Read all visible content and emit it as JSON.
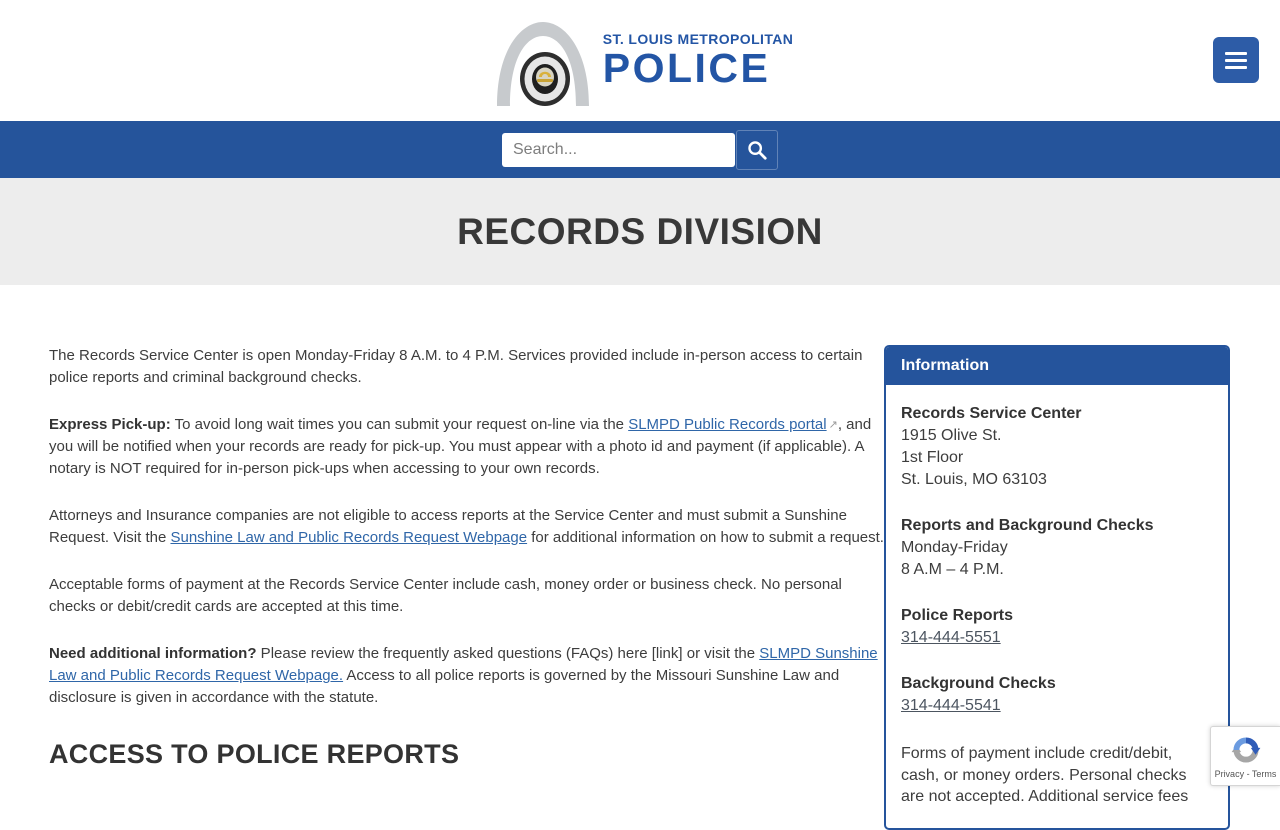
{
  "header": {
    "logo": {
      "line1": "ST. LOUIS METROPOLITAN",
      "line2": "POLICE"
    },
    "menu_icon": "hamburger-icon"
  },
  "search": {
    "placeholder": "Search...",
    "icon": "search-icon"
  },
  "banner": {
    "title": "RECORDS DIVISION"
  },
  "main": {
    "paragraphs": [
      [
        {
          "t": "The Records Service Center is open Monday-Friday 8 A.M. to 4 P.M. Services provided include in-person access to certain police reports and criminal background checks.",
          "s": "plain"
        }
      ],
      [
        {
          "t": "Express Pick-up:",
          "s": "bold"
        },
        {
          "t": " To avoid long wait times you can submit your request on-line via the ",
          "s": "plain"
        },
        {
          "t": "SLMPD Public Records portal",
          "s": "link"
        },
        {
          "t": "↗",
          "s": "ext"
        },
        {
          "t": ", and you will be notified when your records are ready for pick-up. You must appear with a photo id and payment (if applicable). A notary is NOT required for in-person pick-ups when accessing to your own records.",
          "s": "plain"
        }
      ],
      [
        {
          "t": "Attorneys and Insurance companies are not eligible to access reports at the Service Center and must submit a Sunshine Request. Visit the ",
          "s": "plain"
        },
        {
          "t": "Sunshine Law and Public Records Request Webpage",
          "s": "link"
        },
        {
          "t": " for additional information on how to submit a request.",
          "s": "plain"
        }
      ],
      [
        {
          "t": "Acceptable forms of payment at the Records Service Center include cash, money order or business check. No personal checks or debit/credit cards are accepted at this time.",
          "s": "plain"
        }
      ],
      [
        {
          "t": "Need additional information?",
          "s": "bold"
        },
        {
          "t": " Please review the frequently asked questions (FAQs) here [link] or visit the ",
          "s": "plain"
        },
        {
          "t": "SLMPD Sunshine Law and Public Records Request Webpage.",
          "s": "link"
        },
        {
          "t": " Access to all police reports is governed by the Missouri Sunshine Law and disclosure is given in accordance with the statute.",
          "s": "plain"
        }
      ]
    ],
    "section_heading": "ACCESS TO POLICE REPORTS"
  },
  "sidebar": {
    "title": "Information",
    "groups": [
      {
        "title": "Records Service Center",
        "lines": [
          {
            "text": "1915 Olive St."
          },
          {
            "text": "1st Floor"
          },
          {
            "text": "St. Louis, MO 63103"
          }
        ]
      },
      {
        "title": "Reports and Background Checks",
        "lines": [
          {
            "text": "Monday-Friday"
          },
          {
            "text": "8 A.M – 4 P.M."
          }
        ]
      },
      {
        "title": "Police Reports",
        "lines": [
          {
            "text": "314-444-5551",
            "link": true
          }
        ]
      },
      {
        "title": "Background Checks",
        "lines": [
          {
            "text": "314-444-5541",
            "link": true
          }
        ]
      }
    ],
    "note": "Forms of payment include credit/debit, cash, or money orders. Personal checks are not accepted. Additional service fees"
  },
  "recaptcha": {
    "privacy": "Privacy",
    "separator": " - ",
    "terms": "Terms",
    "icon": "recaptcha-logo-icon"
  },
  "colors": {
    "brand_blue": "#25549B",
    "hamburger_blue": "#2D5CA7",
    "logo_blue": "#2355A5",
    "banner_gray": "#EDEDED",
    "body_text": "#3D3D3D",
    "link_blue": "#2F66A8",
    "phone_link": "#4C5560"
  }
}
